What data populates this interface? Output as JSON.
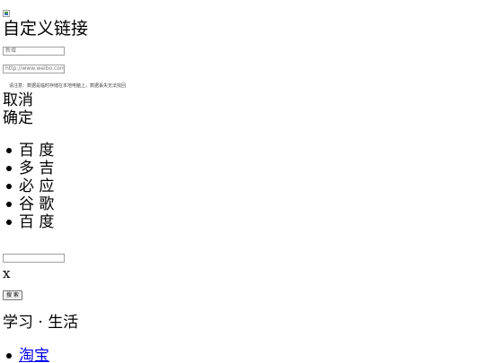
{
  "dialog": {
    "title": "自定义链接",
    "name_placeholder": "新增",
    "url_placeholder": "http://www.weibo.com/",
    "hint": "请注意：数据是临时存储在本地电脑上，数据丢失无法找回",
    "cancel_label": "取消",
    "ok_label": "确定"
  },
  "engines": {
    "items": [
      {
        "label": "百 度"
      },
      {
        "label": "多 吉"
      },
      {
        "label": "必 应"
      },
      {
        "label": "谷 歌"
      },
      {
        "label": "百 度"
      }
    ]
  },
  "search": {
    "value": "",
    "clear_label": "x",
    "button_label": "搜 索"
  },
  "section": {
    "title": "学习 · 生活",
    "links": [
      {
        "label": "淘宝"
      }
    ]
  }
}
